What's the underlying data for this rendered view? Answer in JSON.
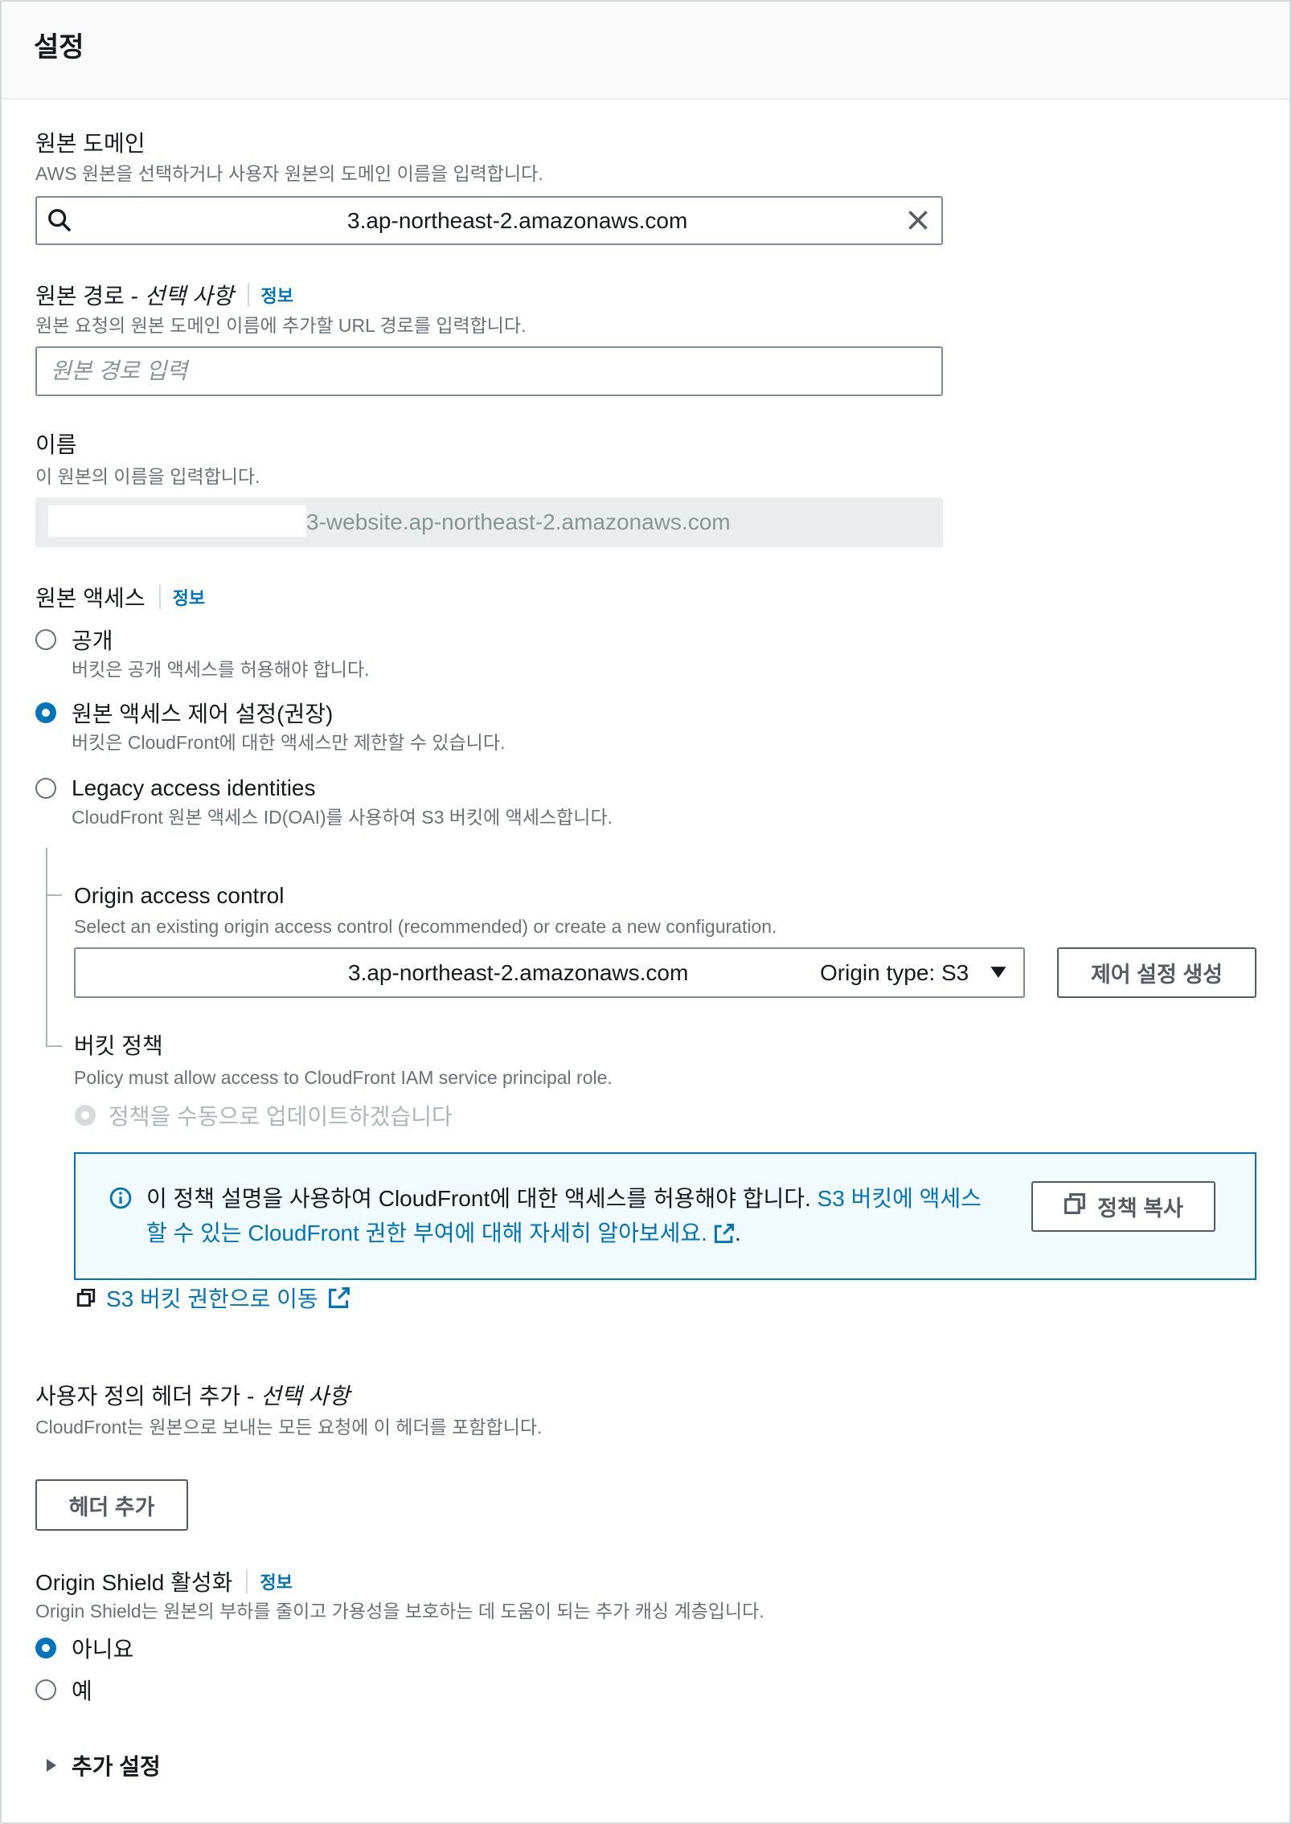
{
  "section": {
    "title": "설정"
  },
  "origin_domain": {
    "label": "원본 도메인",
    "description": "AWS 원본을 선택하거나 사용자 원본의 도메인 이름을 입력합니다.",
    "value": "3.ap-northeast-2.amazonaws.com"
  },
  "origin_path": {
    "label": "원본 경로 - ",
    "label_optional": "선택 사항",
    "info": "정보",
    "description": "원본 요청의 원본 도메인 이름에 추가할 URL 경로를 입력합니다.",
    "placeholder": "원본 경로 입력"
  },
  "name": {
    "label": "이름",
    "description": "이 원본의 이름을 입력합니다.",
    "value": "3-website.ap-northeast-2.amazonaws.com",
    "disabled": true
  },
  "origin_access": {
    "label": "원본 액세스",
    "info": "정보",
    "options": [
      {
        "label": "공개",
        "description": "버킷은 공개 액세스를 허용해야 합니다.",
        "selected": false
      },
      {
        "label": "원본 액세스 제어 설정(권장)",
        "description": "버킷은 CloudFront에 대한 액세스만 제한할 수 있습니다.",
        "selected": true
      },
      {
        "label": "Legacy access identities",
        "description": "CloudFront 원본 액세스 ID(OAI)를 사용하여 S3 버킷에 액세스합니다.",
        "selected": false
      }
    ]
  },
  "origin_access_control": {
    "label": "Origin access control",
    "description": "Select an existing origin access control (recommended) or create a new configuration.",
    "selected_value": "3.ap-northeast-2.amazonaws.com",
    "selected_meta": "Origin type: S3",
    "create_button": "제어 설정 생성"
  },
  "bucket_policy": {
    "label": "버킷 정책",
    "description": "Policy must allow access to CloudFront IAM service principal role.",
    "option": {
      "label": "정책을 수동으로 업데이트하겠습니다",
      "selected": true,
      "disabled": true
    },
    "alert": {
      "text": "이 정책 설명을 사용하여 CloudFront에 대한 액세스를 허용해야 합니다. ",
      "link": "S3 버킷에 액세스할 수 있는 CloudFront 권한 부여에 대해 자세히 알아보세요.",
      "suffix": ".",
      "copy_button": "정책 복사"
    },
    "permissions_link": "S3 버킷 권한으로 이동"
  },
  "custom_headers": {
    "label": "사용자 정의 헤더 추가 - ",
    "label_optional": "선택 사항",
    "description": "CloudFront는 원본으로 보내는 모든 요청에 이 헤더를 포함합니다.",
    "add_button": "헤더 추가"
  },
  "origin_shield": {
    "label": "Origin Shield 활성화",
    "info": "정보",
    "description": "Origin Shield는 원본의 부하를 줄이고 가용성을 보호하는 데 도움이 되는 추가 캐싱 계층입니다.",
    "options": [
      {
        "label": "아니요",
        "selected": true
      },
      {
        "label": "예",
        "selected": false
      }
    ]
  },
  "additional_settings": {
    "label": "추가 설정",
    "expanded": false
  },
  "icons": {
    "domain_search": "search-icon",
    "domain_clear": "close-icon",
    "select_caret": "caret-down-icon",
    "alert_info": "info-icon",
    "copy": "copy-icon",
    "external": "external-link-icon",
    "expander": "caret-right-icon"
  },
  "colors": {
    "link": "#0073bb",
    "text": "#16191f",
    "muted": "#687078",
    "disabled_text": "#879596",
    "input_border": "#7d8998",
    "alert_bg": "#f1faff",
    "button": "#545b64",
    "divider": "#d5dbdb",
    "radio_selected": "#0073bb"
  }
}
